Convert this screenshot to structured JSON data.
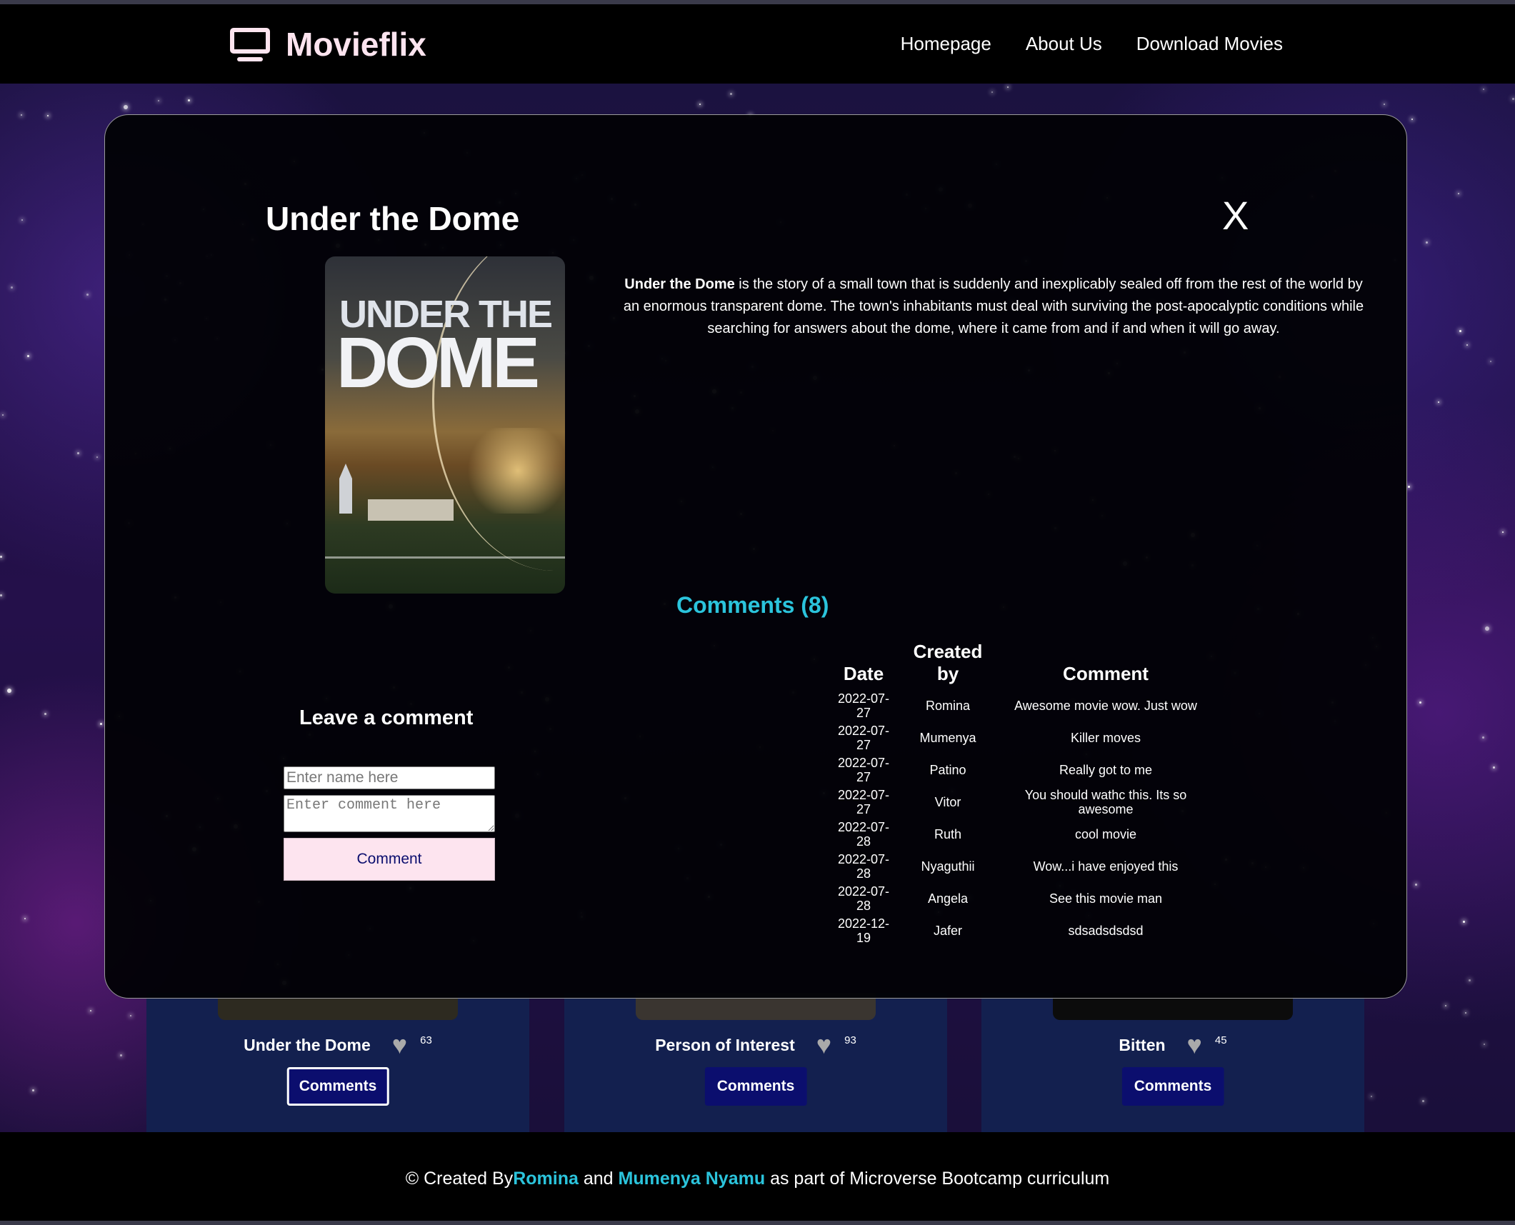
{
  "header": {
    "brand_name": "Movieflix",
    "nav": [
      "Homepage",
      "About Us",
      "Download Movies"
    ]
  },
  "cards": [
    {
      "title": "Under the Dome",
      "likes": "63",
      "button": "Comments"
    },
    {
      "title": "Person of Interest",
      "likes": "93",
      "button": "Comments"
    },
    {
      "title": "Bitten",
      "likes": "45",
      "button": "Comments"
    }
  ],
  "modal": {
    "title": "Under the Dome",
    "close_label": "X",
    "poster_text": {
      "line1": "UNDER THE",
      "line2": "DOME"
    },
    "description_bold": "Under the Dome",
    "description_rest": " is the story of a small town that is suddenly and inexplicably sealed off from the rest of the world by an enormous transparent dome. The town's inhabitants must deal with surviving the post-apocalyptic conditions while searching for answers about the dome, where it came from and if and when it will go away.",
    "comments_heading": "Comments (8)",
    "table_headers": {
      "date": "Date",
      "created_by": "Created by",
      "comment": "Comment"
    },
    "comments": [
      {
        "date": "2022-07-27",
        "by": "Romina",
        "text": "Awesome movie wow. Just wow"
      },
      {
        "date": "2022-07-27",
        "by": "Mumenya",
        "text": "Killer moves"
      },
      {
        "date": "2022-07-27",
        "by": "Patino",
        "text": "Really got to me"
      },
      {
        "date": "2022-07-27",
        "by": "Vitor",
        "text": "You should wathc this. Its so awesome"
      },
      {
        "date": "2022-07-28",
        "by": "Ruth",
        "text": "cool movie"
      },
      {
        "date": "2022-07-28",
        "by": "Nyaguthii",
        "text": "Wow...i have enjoyed this"
      },
      {
        "date": "2022-07-28",
        "by": "Angela",
        "text": "See this movie man"
      },
      {
        "date": "2022-12-19",
        "by": "Jafer",
        "text": "sdsadsdsdsd"
      }
    ],
    "form": {
      "title": "Leave a comment",
      "name_placeholder": "Enter name here",
      "comment_placeholder": "Enter comment here",
      "submit_label": "Comment"
    }
  },
  "footer": {
    "prefix": "© Created By ",
    "author1": "Romina",
    "mid": " and ",
    "author2": "Mumenya Nyamu",
    "suffix": " as part of Microverse Bootcamp curriculum"
  },
  "colors": {
    "brand": "#fde4ef",
    "accent": "#2bc4dc",
    "button_dark": "#0b0e6e",
    "card_bg": "#13204f"
  }
}
